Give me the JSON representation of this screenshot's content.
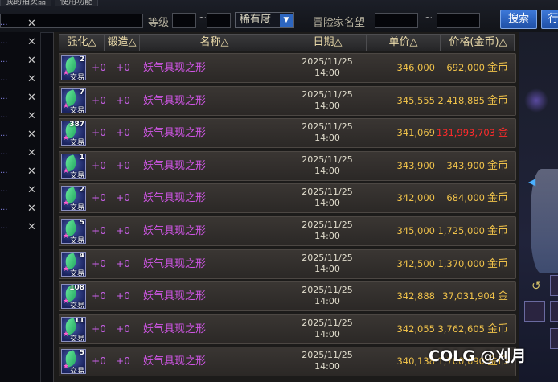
{
  "top_tabs": [
    "我的拍卖品",
    "使用功能"
  ],
  "filters": {
    "level_label": "等级",
    "range_sep": "~",
    "rarity_value": "稀有度",
    "adventurer_label": "冒险家名望",
    "search_button": "搜索",
    "right_button": "行"
  },
  "left_list": [
    {
      "text": "..."
    },
    {
      "text": "..."
    },
    {
      "text": "..."
    },
    {
      "text": "..."
    },
    {
      "text": "..."
    },
    {
      "text": "..."
    },
    {
      "text": "..."
    },
    {
      "text": "..."
    },
    {
      "text": "..."
    },
    {
      "text": "..."
    },
    {
      "text": "..."
    },
    {
      "text": "..."
    }
  ],
  "close_glyph": "✕",
  "table": {
    "headers": {
      "enhance": "强化△",
      "forge": "锻造△",
      "name": "名称△",
      "date": "日期△",
      "unit_price": "单价△",
      "price": "价格(金币)△"
    },
    "icon_tradable": "交易",
    "currency": "金币",
    "rows": [
      {
        "qty": "2",
        "enhance": "+0",
        "forge": "+0",
        "name": "妖气具现之形",
        "date": "2025/11/25",
        "time": "14:00",
        "unit": "346,000",
        "total": "692,000",
        "hot": false
      },
      {
        "qty": "7",
        "enhance": "+0",
        "forge": "+0",
        "name": "妖气具现之形",
        "date": "2025/11/25",
        "time": "14:00",
        "unit": "345,555",
        "total": "2,418,885",
        "hot": false
      },
      {
        "qty": "387",
        "enhance": "+0",
        "forge": "+0",
        "name": "妖气具现之形",
        "date": "2025/11/25",
        "time": "14:00",
        "unit": "341,069",
        "total": "131,993,703",
        "hot": true
      },
      {
        "qty": "1",
        "enhance": "+0",
        "forge": "+0",
        "name": "妖气具现之形",
        "date": "2025/11/25",
        "time": "14:00",
        "unit": "343,900",
        "total": "343,900",
        "hot": false
      },
      {
        "qty": "2",
        "enhance": "+0",
        "forge": "+0",
        "name": "妖气具现之形",
        "date": "2025/11/25",
        "time": "14:00",
        "unit": "342,000",
        "total": "684,000",
        "hot": false
      },
      {
        "qty": "5",
        "enhance": "+0",
        "forge": "+0",
        "name": "妖气具现之形",
        "date": "2025/11/25",
        "time": "14:00",
        "unit": "345,000",
        "total": "1,725,000",
        "hot": false
      },
      {
        "qty": "4",
        "enhance": "+0",
        "forge": "+0",
        "name": "妖气具现之形",
        "date": "2025/11/25",
        "time": "14:00",
        "unit": "342,500",
        "total": "1,370,000",
        "hot": false
      },
      {
        "qty": "108",
        "enhance": "+0",
        "forge": "+0",
        "name": "妖气具现之形",
        "date": "2025/11/25",
        "time": "14:00",
        "unit": "342,888",
        "total": "37,031,904",
        "hot": false
      },
      {
        "qty": "11",
        "enhance": "+0",
        "forge": "+0",
        "name": "妖气具现之形",
        "date": "2025/11/25",
        "time": "14:00",
        "unit": "342,055",
        "total": "3,762,605",
        "hot": false
      },
      {
        "qty": "5",
        "enhance": "+0",
        "forge": "+0",
        "name": "妖气具现之形",
        "date": "2025/11/25",
        "time": "14:00",
        "unit": "340,138",
        "total": "1,700,690",
        "hot": false
      }
    ]
  },
  "watermark": "COLG @刈月",
  "colors": {
    "accent": "#2d66c0",
    "item_name": "#d256e8",
    "price": "#f0c24a",
    "hot_price": "#ff2b2b"
  }
}
